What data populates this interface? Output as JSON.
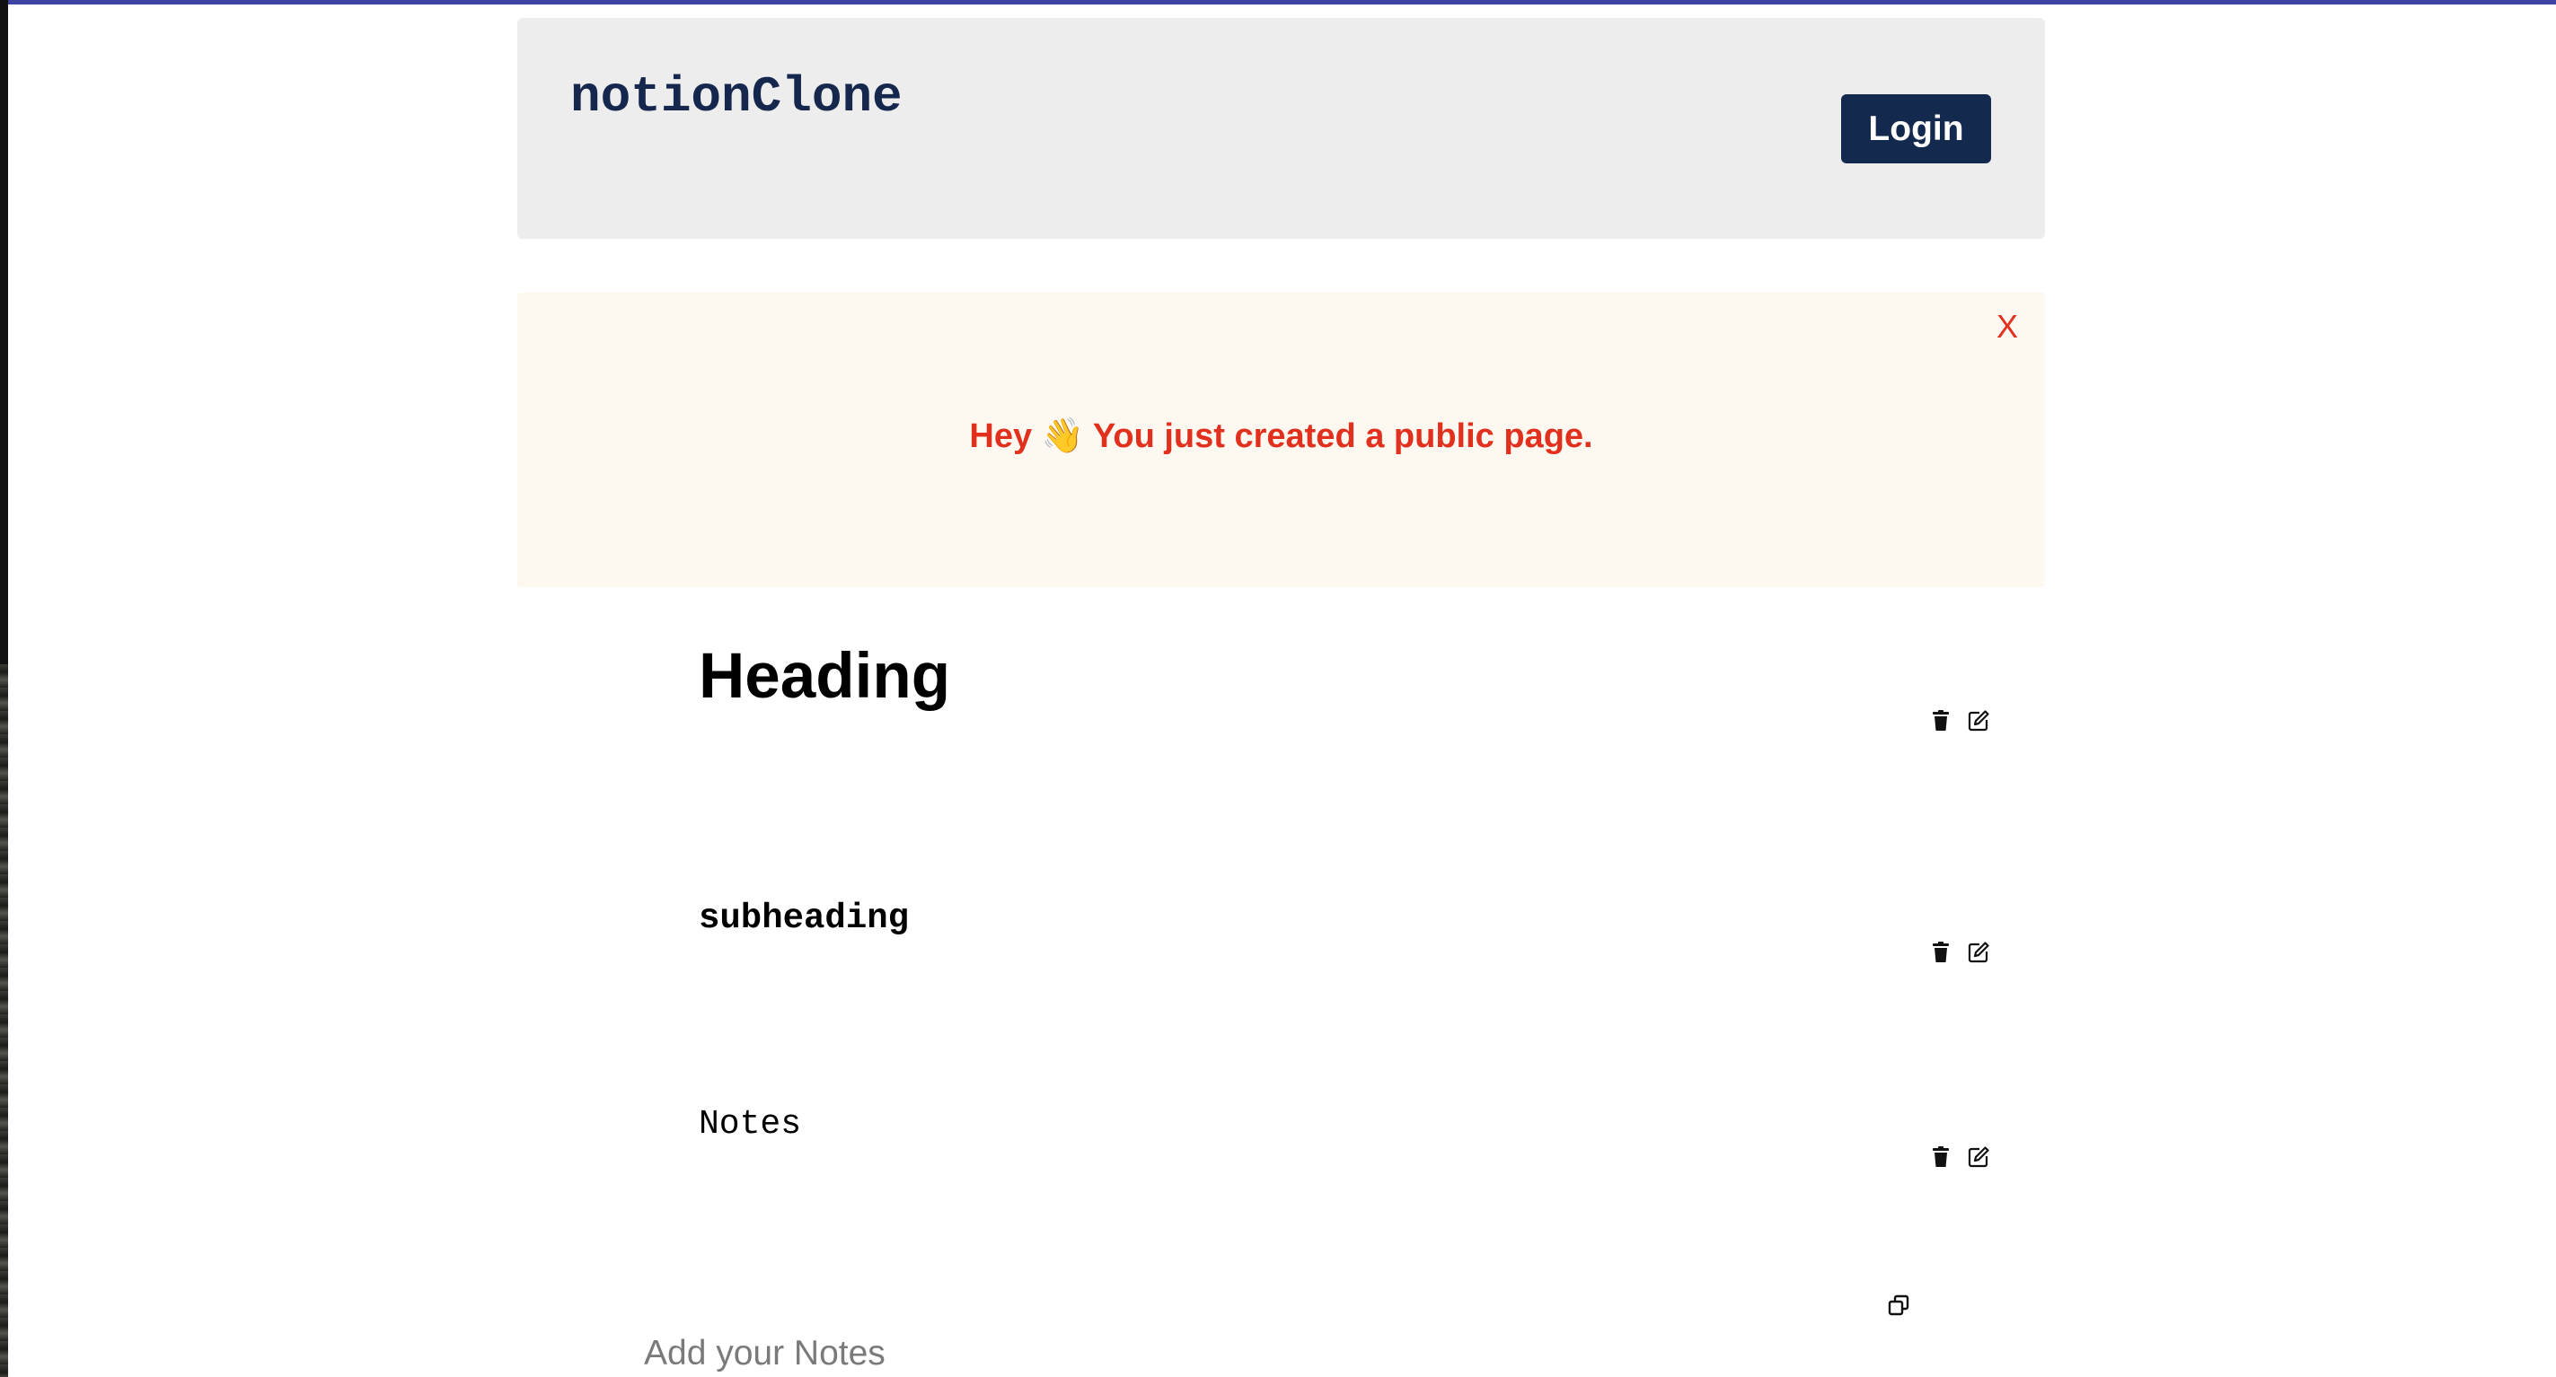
{
  "header": {
    "brand": "notionClone",
    "login_label": "Login"
  },
  "banner": {
    "close_label": "X",
    "message": "Hey 👋 You just created a public page."
  },
  "blocks": [
    {
      "type": "heading",
      "text": "Heading"
    },
    {
      "type": "subheading",
      "text": "subheading"
    },
    {
      "type": "notes",
      "text": "Notes"
    }
  ],
  "block_actions": {
    "delete_icon": "trash-icon",
    "edit_icon": "edit-icon"
  },
  "duplicate_icon": "duplicate-icon",
  "add_notes": {
    "placeholder": "Add your Notes"
  },
  "colors": {
    "brand": "#16274d",
    "login_bg": "#13294e",
    "banner_bg": "#fdf8f0",
    "banner_text": "#e2301f",
    "header_bg": "#ededed",
    "top_accent": "#3d44a3"
  }
}
